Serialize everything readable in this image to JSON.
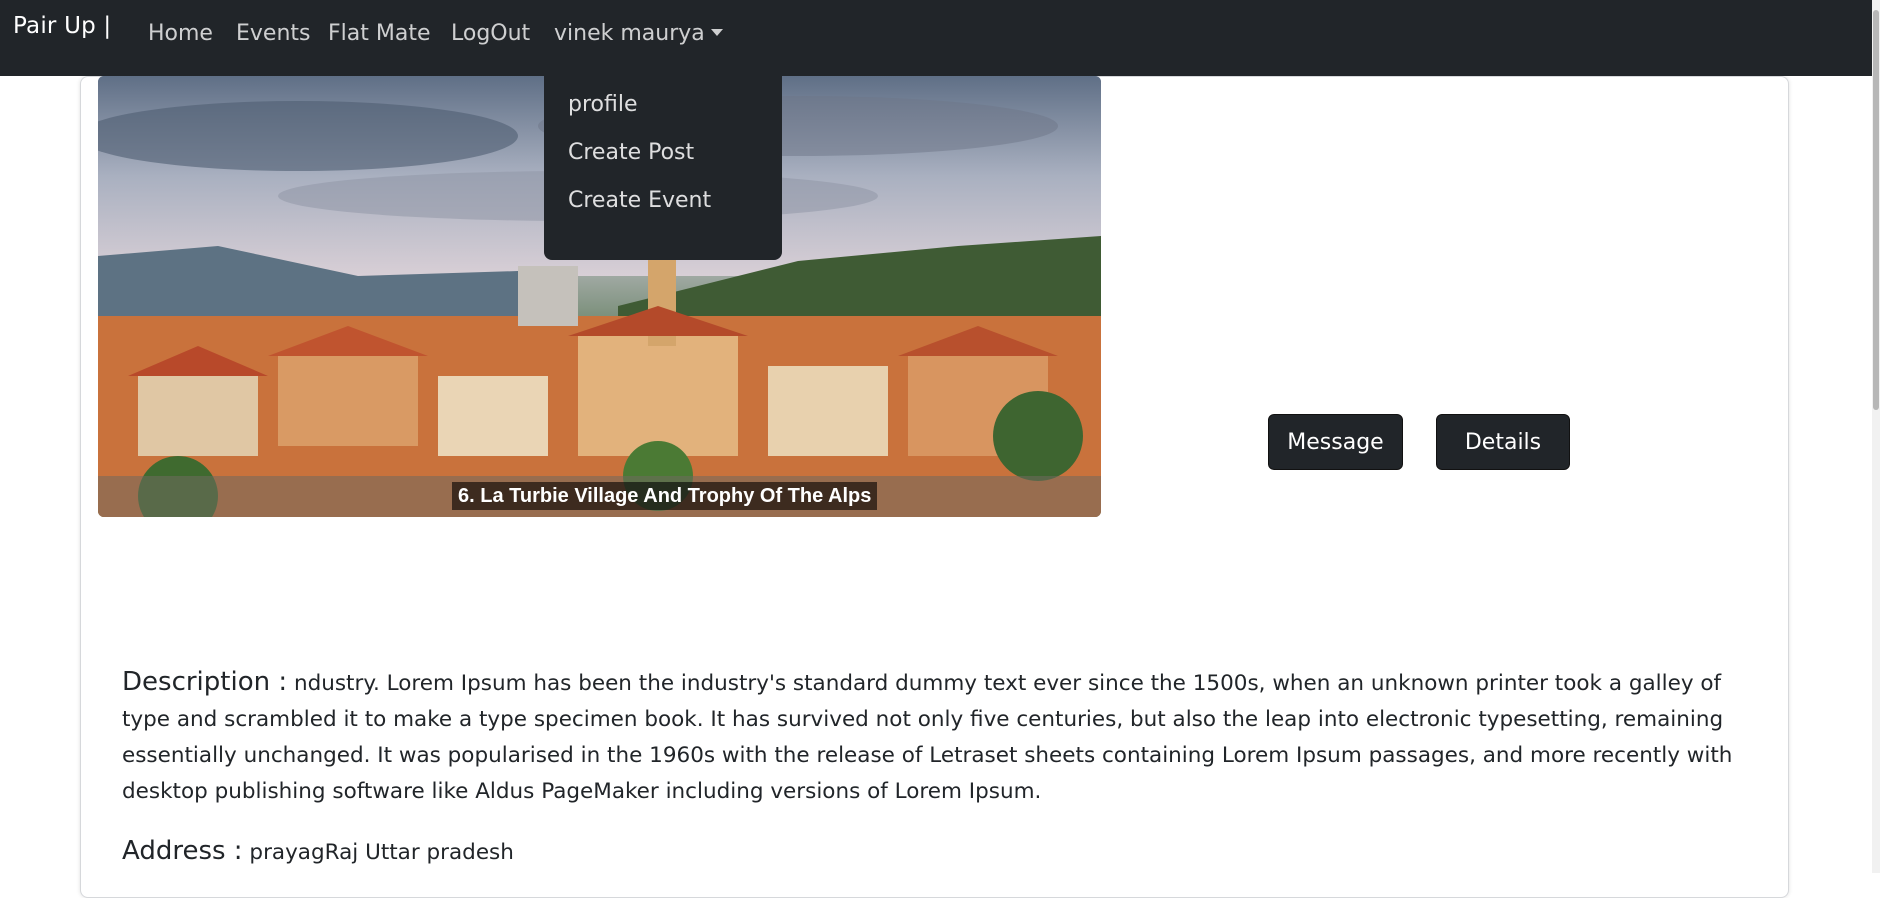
{
  "navbar": {
    "brand": "Pair Up |",
    "links": [
      "Home",
      "Events",
      "Flat Mate",
      "LogOut"
    ],
    "user_menu": "vinek maurya"
  },
  "dropdown": {
    "items": [
      "profile",
      "Create Post",
      "Create Event"
    ]
  },
  "post": {
    "image_caption": "6. La Turbie Village And Trophy Of The Alps",
    "message_button": "Message",
    "details_button": "Details",
    "description_label": "Description :",
    "description_text": "ndustry. Lorem Ipsum has been the industry's standard dummy text ever since the 1500s, when an unknown printer took a galley of type and scrambled it to make a type specimen book. It has survived not only five centuries, but also the leap into electronic typesetting, remaining essentially unchanged. It was popularised in the 1960s with the release of Letraset sheets containing Lorem Ipsum passages, and more recently with desktop publishing software like Aldus PageMaker including versions of Lorem Ipsum.",
    "address_label": "Address :",
    "address_text": "prayagRaj Uttar pradesh"
  },
  "colors": {
    "navbar_bg": "#212529",
    "button_bg": "#212529"
  }
}
